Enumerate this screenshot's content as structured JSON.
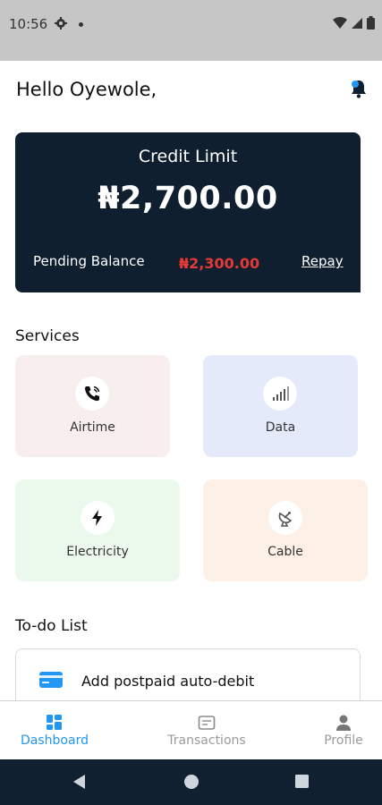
{
  "status_bar": {
    "time": "10:56"
  },
  "header": {
    "greeting": "Hello Oyewole,"
  },
  "credit_card": {
    "title": "Credit Limit",
    "amount": "₦2,700.00",
    "pending_label": "Pending Balance",
    "pending_amount": "₦2,300.00",
    "repay_label": "Repay"
  },
  "services": {
    "title": "Services",
    "items": [
      {
        "label": "Airtime",
        "icon": "phone-ringing-icon",
        "bg": "#f8eeee"
      },
      {
        "label": "Data",
        "icon": "signal-bars-icon",
        "bg": "#e4eafa"
      },
      {
        "label": "Electricity",
        "icon": "lightning-icon",
        "bg": "#ebf8ec"
      },
      {
        "label": "Cable",
        "icon": "satellite-dish-icon",
        "bg": "#fdf0e6"
      }
    ]
  },
  "todo": {
    "title": "To-do List",
    "items": [
      {
        "label": "Add postpaid auto-debit",
        "icon": "credit-card-icon",
        "icon_color": "#2196f3"
      }
    ]
  },
  "bottom_nav": {
    "items": [
      {
        "label": "Dashboard",
        "icon": "dashboard-icon",
        "active": true
      },
      {
        "label": "Transactions",
        "icon": "transactions-icon",
        "active": false
      },
      {
        "label": "Profile",
        "icon": "person-icon",
        "active": false
      }
    ]
  },
  "colors": {
    "card_bg": "#0f1f30",
    "accent_blue": "#2196f3",
    "pending_red": "#e53935",
    "system_nav": "#102030"
  }
}
